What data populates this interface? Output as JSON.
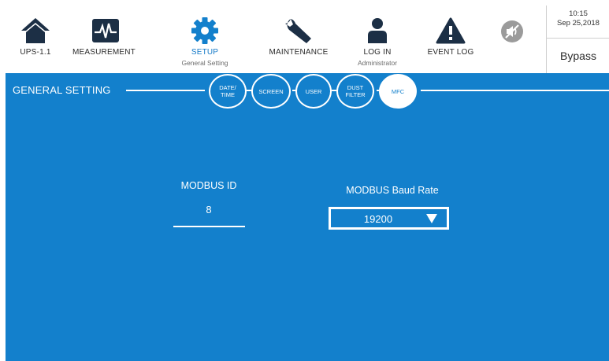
{
  "nav": {
    "items": [
      {
        "label": "UPS-1.1",
        "sub": "",
        "icon": "home-icon"
      },
      {
        "label": "MEASUREMENT",
        "sub": "",
        "icon": "waveform-icon"
      },
      {
        "label": "SETUP",
        "sub": "General Setting",
        "icon": "gear-icon"
      },
      {
        "label": "MAINTENANCE",
        "sub": "",
        "icon": "wrench-icon"
      },
      {
        "label": "LOG IN",
        "sub": "Administrator",
        "icon": "user-icon"
      },
      {
        "label": "EVENT LOG",
        "sub": "",
        "icon": "warning-icon"
      }
    ],
    "mute_icon": "mute-speaker-icon",
    "active_color": "#1278c7"
  },
  "status": {
    "time": "10:15",
    "date": "Sep 25,2018",
    "mode": "Bypass"
  },
  "panel": {
    "background": "#1380cc",
    "section_title": "GENERAL SETTING",
    "tabs": [
      {
        "label": "DATE/\nTIME"
      },
      {
        "label": "SCREEN"
      },
      {
        "label": "USER"
      },
      {
        "label": "DUST\nFILTER"
      },
      {
        "label": "MFC"
      }
    ],
    "active_tab": "MFC",
    "modbus_id": {
      "label": "MODBUS ID",
      "value": "8"
    },
    "baud_rate": {
      "label": "MODBUS Baud Rate",
      "value": "19200"
    }
  }
}
